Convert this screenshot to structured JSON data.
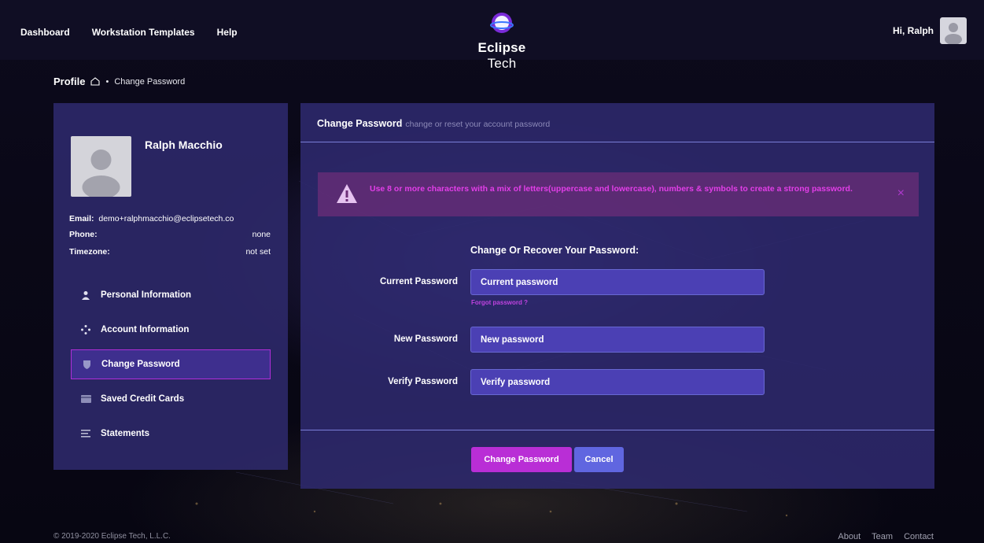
{
  "nav": {
    "dashboard": "Dashboard",
    "workstation_templates": "Workstation Templates",
    "help": "Help"
  },
  "logo": {
    "brand_bold": "Eclipse",
    "brand_light": " Tech"
  },
  "user": {
    "greeting": "Hi, Ralph",
    "avatar_icon": "user-silhouette-icon"
  },
  "breadcrumb": {
    "title": "Profile",
    "home_icon": "home-icon",
    "separator": "•",
    "current": "Change Password"
  },
  "profile": {
    "name": "Ralph Macchio",
    "email_label": "Email:",
    "email_value": "demo+ralphmacchio@eclipsetech.co",
    "phone_label": "Phone:",
    "phone_value": "none",
    "timezone_label": "Timezone:",
    "timezone_value": "not set"
  },
  "menu": [
    {
      "label": "Personal Information",
      "icon": "person-icon",
      "active": false
    },
    {
      "label": "Account Information",
      "icon": "diamond-dots-icon",
      "active": false
    },
    {
      "label": "Change Password",
      "icon": "shield-icon",
      "active": true
    },
    {
      "label": "Saved Credit Cards",
      "icon": "card-icon",
      "active": false
    },
    {
      "label": "Statements",
      "icon": "list-icon",
      "active": false
    }
  ],
  "main": {
    "title": "Change Password",
    "subtitle": "change or reset your account password",
    "alert": "Use 8 or more characters with a mix of letters(uppercase and lowercase), numbers & symbols to create a strong password.",
    "alert_close": "×",
    "form_title": "Change Or Recover Your Password:",
    "current_label": "Current Password",
    "current_placeholder": "Current password",
    "forgot": "Forgot password ?",
    "new_label": "New Password",
    "new_placeholder": "New password",
    "verify_label": "Verify Password",
    "verify_placeholder": "Verify password",
    "submit": "Change Password",
    "cancel": "Cancel"
  },
  "footer": {
    "copyright": "© 2019-2020 Eclipse Tech, L.L.C.",
    "about": "About",
    "team": "Team",
    "contact": "Contact"
  },
  "colors": {
    "accent": "#b92ed6",
    "secondary": "#6066e0",
    "alert_text": "#e23ee8"
  }
}
